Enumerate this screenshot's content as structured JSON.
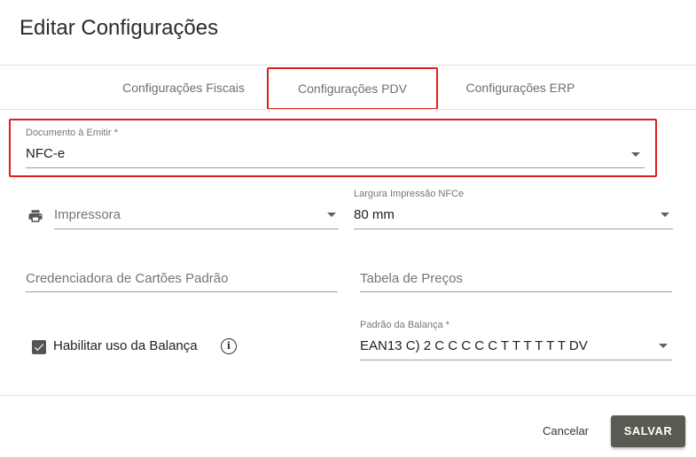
{
  "dialog": {
    "title": "Editar Configurações"
  },
  "tabs": [
    {
      "label": "Configurações Fiscais",
      "active": false
    },
    {
      "label": "Configurações PDV",
      "active": true
    },
    {
      "label": "Configurações ERP",
      "active": false
    }
  ],
  "form": {
    "documento": {
      "label": "Documento à Emitir *",
      "value": "NFC-e"
    },
    "impressora": {
      "icon": "printer-icon",
      "placeholder": "Impressora",
      "value": ""
    },
    "largura": {
      "label": "Largura Impressão NFCe",
      "value": "80 mm"
    },
    "credenciadora": {
      "placeholder": "Credenciadora de Cartões Padrão",
      "value": ""
    },
    "tabela_precos": {
      "placeholder": "Tabela de Preços",
      "value": ""
    },
    "balanca_checkbox": {
      "label": "Habilitar uso da Balança",
      "checked": true,
      "info_icon": "info-icon",
      "info_glyph": "i"
    },
    "padrao_balanca": {
      "label": "Padrão da Balança *",
      "value": "EAN13 C) 2 C C C C C T T T T T T DV"
    }
  },
  "footer": {
    "cancel_label": "Cancelar",
    "save_label": "SALVAR"
  },
  "colors": {
    "highlight": "#e11d1d",
    "save_button": "#5a5a52",
    "checkbox": "#555555"
  }
}
